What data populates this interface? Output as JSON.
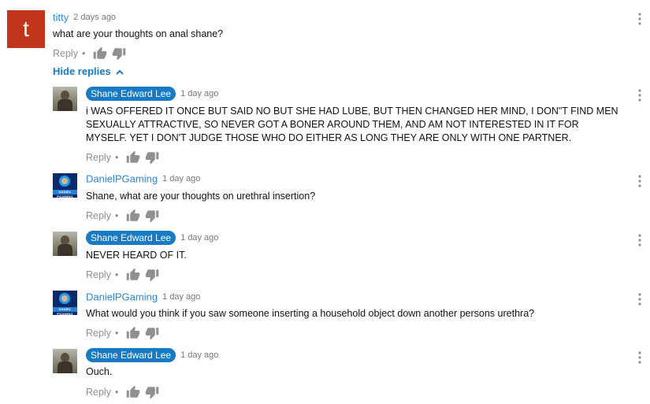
{
  "colors": {
    "link_blue": "#167ac6",
    "avatar_t_bg": "#c1351a",
    "muted": "#8e8e8e"
  },
  "icons": [
    "thumbs-up-icon",
    "thumbs-down-icon",
    "more-vert-icon",
    "chevron-up-icon"
  ],
  "top_comment": {
    "avatar_letter": "t",
    "author": "titty",
    "time": "2 days ago",
    "text": "what are your thoughts on anal shane?",
    "reply_label": "Reply",
    "separator": "•"
  },
  "hide_replies_label": "Hide replies",
  "replies": [
    {
      "author": "Shane Edward Lee",
      "time": "1 day ago",
      "text": "i WAS OFFERED IT ONCE BUT SAID NO BUT SHE HAD LUBE, BUT THEN CHANGED HER MIND, I DON\"T FIND MEN SEXUALLY ATTRACTIVE, SO NEVER GOT A BONER AROUND THEM, AND AM NOT INTERESTED IN IT FOR MYSELF. YET I DON'T JUDGE THOSE WHO DO EITHER AS LONG THEY ARE ONLY WITH ONE PARTNER.",
      "reply_label": "Reply",
      "separator": "•"
    },
    {
      "author": "DanielPGaming",
      "time": "1 day ago",
      "text": "Shane, what are your thoughts on urethral insertion?",
      "reply_label": "Reply",
      "separator": "•",
      "avatar_band_text": "DANIEL PGAMING"
    },
    {
      "author": "Shane Edward Lee",
      "time": "1 day ago",
      "text": "NEVER HEARD OF IT.",
      "reply_label": "Reply",
      "separator": "•"
    },
    {
      "author": "DanielPGaming",
      "time": "1 day ago",
      "text": "What would you think if you saw someone inserting a household object down another persons urethra?",
      "reply_label": "Reply",
      "separator": "•",
      "avatar_band_text": "DANIEL PGAMING"
    },
    {
      "author": "Shane Edward Lee",
      "time": "1 day ago",
      "text": "Ouch.",
      "reply_label": "Reply",
      "separator": "•"
    }
  ]
}
